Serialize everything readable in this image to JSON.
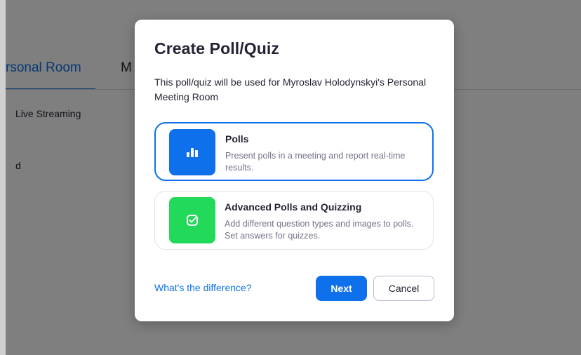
{
  "background": {
    "tab_active": "rsonal Room",
    "tab_next": "M",
    "row1": "Live Streaming",
    "row2": "d"
  },
  "modal": {
    "title": "Create Poll/Quiz",
    "description": "This poll/quiz will be used for Myroslav Holodynskyi's Personal Meeting Room",
    "options": [
      {
        "title": "Polls",
        "subtitle": "Present polls in a meeting and report real-time results.",
        "icon": "bar-chart-icon",
        "color": "#0e71eb",
        "selected": true
      },
      {
        "title": "Advanced Polls and Quizzing",
        "subtitle": "Add different question types and images to polls. Set answers for quizzes.",
        "icon": "checkbox-icon",
        "color": "#23d959",
        "selected": false
      }
    ],
    "difference_link": "What's the difference?",
    "next_label": "Next",
    "cancel_label": "Cancel"
  },
  "colors": {
    "accent": "#0e71eb",
    "green": "#23d959",
    "text": "#232333",
    "muted": "#747487"
  }
}
